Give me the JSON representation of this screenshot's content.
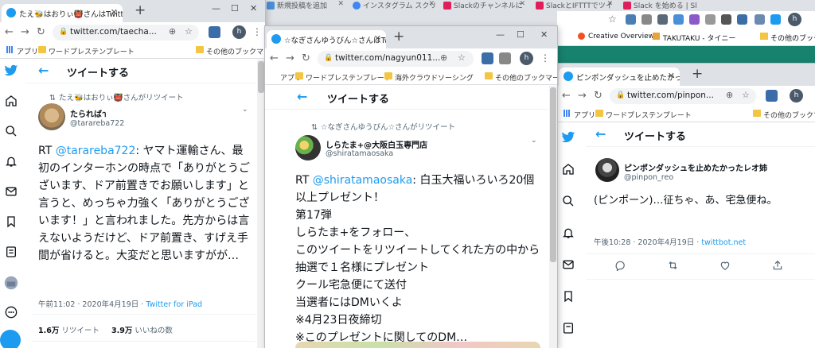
{
  "background_tabs": [
    {
      "label": "新規投稿を追加",
      "color": "#4a90d9"
    },
    {
      "label": "インスタグラム スクリ",
      "color": "#4285f4"
    },
    {
      "label": "Slackのチャンネルに",
      "color": "#e01e5a"
    },
    {
      "label": "SlackとIFTTTでツイ",
      "color": "#e01e5a"
    },
    {
      "label": "Slack を始める | Sl",
      "color": "#e01e5a"
    }
  ],
  "background_bookmarks": {
    "creative_overview": "Creative Overview",
    "takutaku": "TAKUTAKU - タイニー",
    "other": "その他のブックマーク"
  },
  "window1": {
    "tab_title": "たえ🐝はおりぃ👹さんはTwitterを",
    "url": "twitter.com/taecha...",
    "bookmarks": {
      "apps": "アプリ",
      "wp": "ワードプレステンプレート",
      "other": "その他のブックマーク"
    },
    "header_title": "ツイートする",
    "retweeted_by": "たえ🐝はおりぃ👹さんがリツイート",
    "display_name": "たらればา",
    "handle": "@tarareba722",
    "body_prefix": "RT ",
    "mention": "@tarareba722",
    "body_text": ": ヤマト運輸さん、最初のインターホンの時点で「ありがとうございます、ドア前置きでお願いします」と言うと、めっちゃ力強く「ありがとうございます！」と言われました。先方からは言えないようだけど、ドア前置き、すげえ手間が省けると。大変だと思いますがが…",
    "time": "午前11:02 · 2020年4月19日 · ",
    "source": "Twitter for iPad",
    "retweets_count": "1.6万",
    "retweets_label": " リツイート",
    "likes_count": "3.9万",
    "likes_label": " いいねの数"
  },
  "window2": {
    "tab_title": "☆なぎさんゆうびん☆さんはTwitterを",
    "url": "twitter.com/nagyun011...",
    "bookmarks": {
      "apps": "アプリ",
      "wp": "ワードプレステンプレート",
      "crowd": "海外クラウドソーシング",
      "other": "その他のブックマーク"
    },
    "header_title": "ツイートする",
    "retweeted_by": "☆なぎさんゆうびん☆さんがリツイート",
    "display_name": "しらたま+@大阪白玉専門店",
    "handle": "@shiratamaosaka",
    "body_prefix": "RT ",
    "mention": "@shiratamaosaka",
    "body_text": ": 白玉大福いろいろ20個以上プレゼント！\n第17弾\nしらたま+をフォロー、\nこのツイートをリツイートしてくれた方の中から抽選で１名様にプレゼント\nクール宅急便にて送付\n当選者にはDMいくよ\n※4月23日夜締切\n※このプレゼントに関してのDM…"
  },
  "window3": {
    "tab_title": "ピンポンダッシュを止めたかったレオ姉",
    "url": "twitter.com/pinpon...",
    "bookmarks": {
      "apps": "アプリ",
      "wp": "ワードプレステンプレート",
      "other": "その他のブックマーク"
    },
    "header_title": "ツイートする",
    "display_name": "ピンポンダッシュを止めたかったレオ姉",
    "handle": "@pinpon_reo",
    "body_text": "(ピンポーン)…征ちゃ、あ、宅急便ね。",
    "time": "午後10:28 · 2020年4月19日 · ",
    "source": "twittbot.net"
  },
  "icons": [
    "twitter-bird-icon",
    "home-icon",
    "explore-icon",
    "notifications-icon",
    "messages-icon",
    "bookmarks-icon",
    "lists-icon",
    "profile-icon",
    "more-icon",
    "compose-icon",
    "back-arrow-icon",
    "retweet-icon",
    "reply-icon",
    "like-icon",
    "share-icon",
    "lock-icon",
    "star-icon",
    "kebab-icon"
  ],
  "colors": {
    "twitter_blue": "#1d9bf0",
    "chrome_bar": "#dee1e6",
    "slack_teal": "#17836f"
  }
}
